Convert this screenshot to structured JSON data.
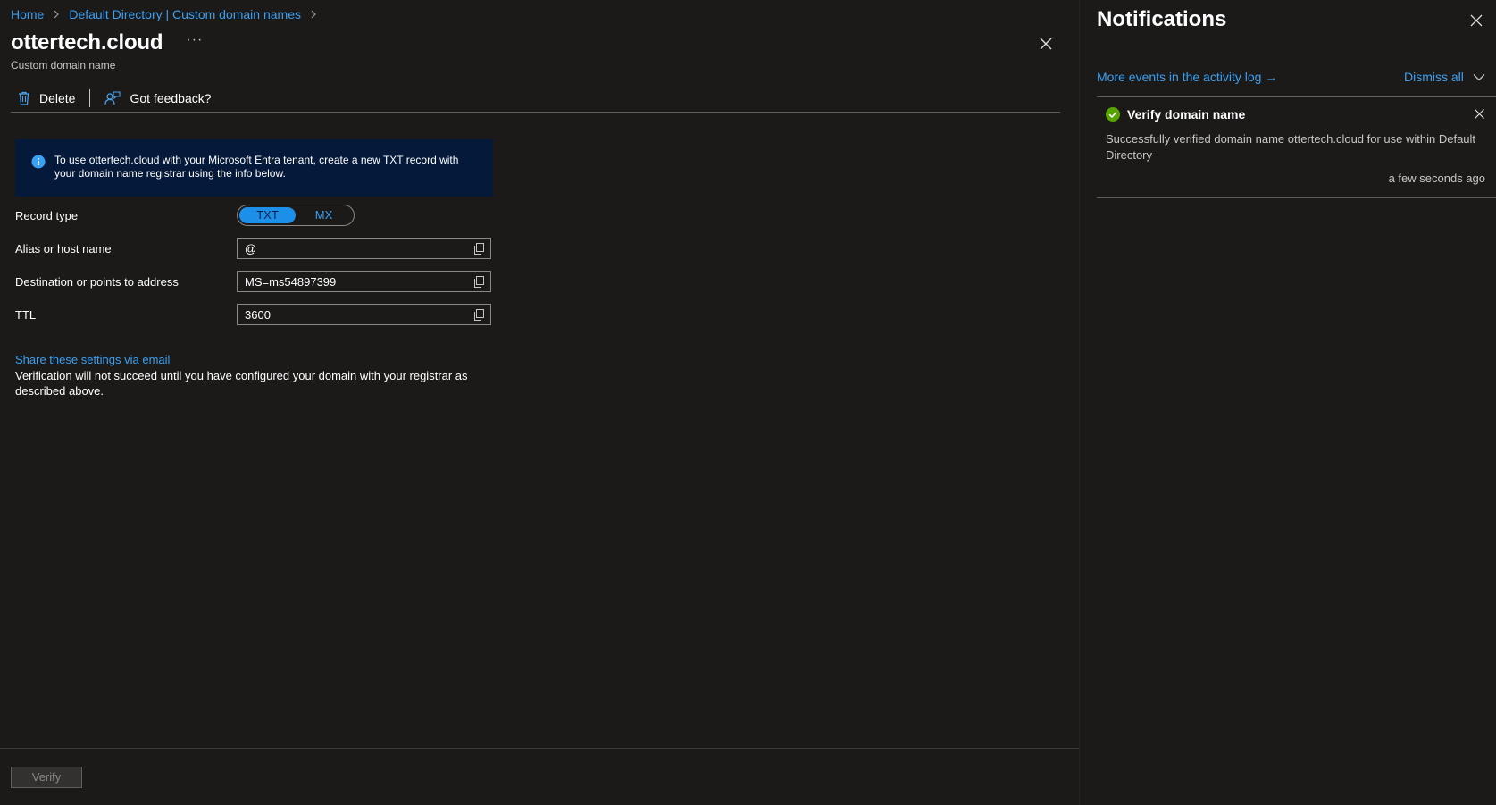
{
  "breadcrumb": {
    "items": [
      "Home",
      "Default Directory | Custom domain names"
    ]
  },
  "header": {
    "title": "ottertech.cloud",
    "more_label": "···",
    "subtitle": "Custom domain name"
  },
  "toolbar": {
    "delete_label": "Delete",
    "feedback_label": "Got feedback?"
  },
  "info": {
    "text": "To use ottertech.cloud with your Microsoft Entra tenant, create a new TXT record with your domain name registrar using the info below."
  },
  "form": {
    "record_type_label": "Record type",
    "record_type_options": [
      "TXT",
      "MX"
    ],
    "record_type_selected": "TXT",
    "alias_label": "Alias or host name",
    "alias_value": "@",
    "destination_label": "Destination or points to address",
    "destination_value": "MS=ms54897399",
    "ttl_label": "TTL",
    "ttl_value": "3600"
  },
  "share_link": "Share these settings via email",
  "verify_note": "Verification will not succeed until you have configured your domain with your registrar as described above.",
  "footer": {
    "verify_label": "Verify"
  },
  "notifications": {
    "title": "Notifications",
    "activity_link": "More events in the activity log →",
    "dismiss_all": "Dismiss all",
    "items": [
      {
        "title": "Verify domain name",
        "body": "Successfully verified domain name ottertech.cloud for use within Default Directory",
        "time": "a few seconds ago",
        "status": "success"
      }
    ]
  },
  "colors": {
    "background": "#1b1a19",
    "link": "#3aa0f3",
    "info_background": "#051a3a",
    "success": "#57a300",
    "toggle_selected": "#1c8fe8"
  },
  "icons": [
    "chevron-right-icon",
    "close-icon",
    "trash-icon",
    "feedback-icon",
    "info-icon",
    "copy-icon",
    "chevron-down-icon",
    "success-check-icon"
  ]
}
